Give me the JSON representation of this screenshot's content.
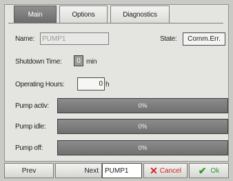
{
  "tabs": [
    {
      "label": "Main",
      "active": true
    },
    {
      "label": "Options",
      "active": false
    },
    {
      "label": "Diagnostics",
      "active": false
    }
  ],
  "form": {
    "name_label": "Name:",
    "name_value": "PUMP1",
    "state_label": "State:",
    "state_value": "Comm.Err.",
    "shutdown_label": "Shutdown Time:",
    "shutdown_value": "0",
    "shutdown_unit": "min",
    "hours_label": "Operating Hours:",
    "hours_value": "0",
    "hours_unit": "h"
  },
  "bars": [
    {
      "label": "Pump activ:",
      "text": "0%",
      "value": 0
    },
    {
      "label": "Pump idle:",
      "text": "0%",
      "value": 0
    },
    {
      "label": "Pump off:",
      "text": "0%",
      "value": 0
    }
  ],
  "toolbar": {
    "prev_label": "Prev",
    "next_label": "Next",
    "current_value": "PUMP1",
    "cancel_label": "Cancel",
    "ok_label": "Ok"
  },
  "colors": {
    "cancel": "#d42020",
    "ok": "#2e9a2e",
    "active_tab": "#6c6c6c"
  }
}
